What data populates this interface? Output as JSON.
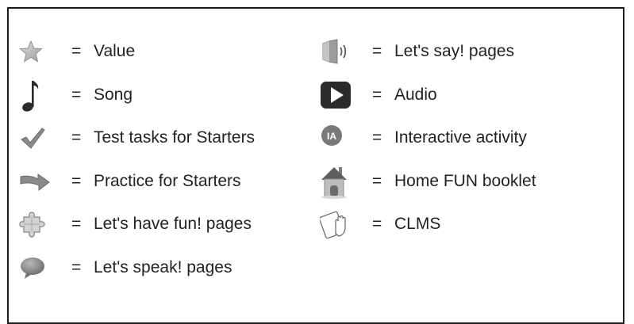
{
  "legend": {
    "equals_sign": "=",
    "left": [
      {
        "icon": "star-icon",
        "label": "Value"
      },
      {
        "icon": "music-note-icon",
        "label": "Song"
      },
      {
        "icon": "checkmark-icon",
        "label": "Test tasks for Starters"
      },
      {
        "icon": "arrow-icon",
        "label": "Practice for Starters"
      },
      {
        "icon": "puzzle-icon",
        "label": "Let's have fun! pages"
      },
      {
        "icon": "speech-bubble-icon",
        "label": "Let's speak! pages"
      }
    ],
    "right": [
      {
        "icon": "speaker-icon",
        "label": "Let's say! pages"
      },
      {
        "icon": "play-icon",
        "label": "Audio"
      },
      {
        "icon": "interactive-activity-icon",
        "label": "Interactive activity",
        "badge_text": "IA"
      },
      {
        "icon": "house-icon",
        "label": "Home FUN booklet"
      },
      {
        "icon": "touch-tablet-icon",
        "label": "CLMS"
      }
    ]
  },
  "colors": {
    "border": "#1e1e1e",
    "icon_dark": "#2b2b2b",
    "icon_mid": "#8a8a8a",
    "icon_light": "#c8c8c8"
  }
}
